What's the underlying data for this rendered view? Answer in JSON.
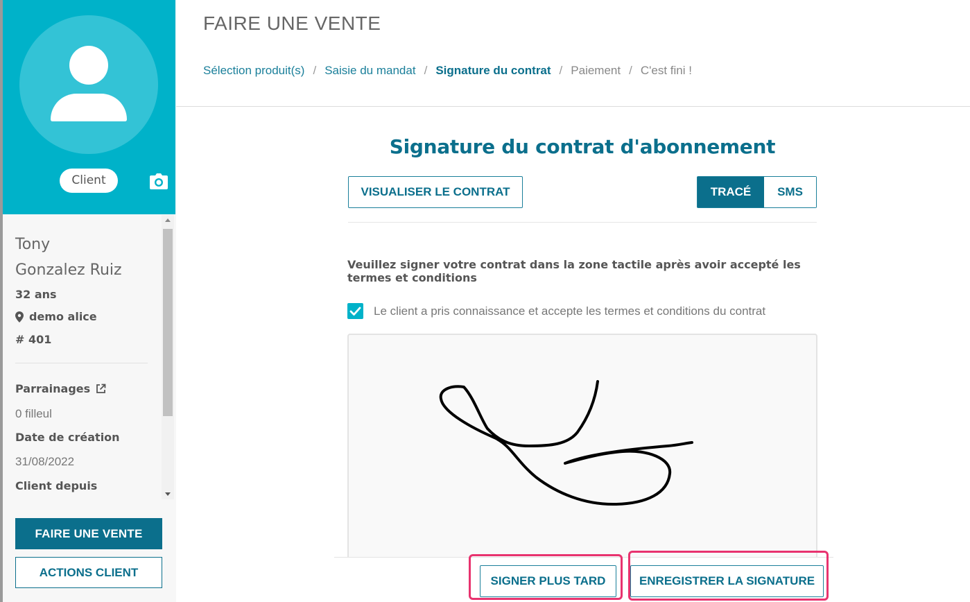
{
  "sidebar": {
    "client_badge": "Client",
    "first_name": "Tony",
    "last_name": "Gonzalez Ruiz",
    "age": "32 ans",
    "location": "demo alice",
    "client_id": "# 401",
    "referrals_label": "Parrainages",
    "referrals_value": "0 filleul",
    "creation_label": "Date de création",
    "creation_value": "31/08/2022",
    "client_since_label": "Client depuis",
    "sell_button": "FAIRE UNE VENTE",
    "actions_button": "ACTIONS CLIENT"
  },
  "header": {
    "title": "FAIRE UNE VENTE",
    "breadcrumb": [
      {
        "label": "Sélection produit(s)"
      },
      {
        "label": "Saisie du mandat"
      },
      {
        "label": "Signature du contrat"
      },
      {
        "label": "Paiement"
      },
      {
        "label": "C'est fini !"
      }
    ],
    "separator": "/"
  },
  "main": {
    "section_title": "Signature du contrat d'abonnement",
    "view_contract_button": "VISUALISER LE CONTRAT",
    "toggle": {
      "trace": "TRACÉ",
      "sms": "SMS",
      "selected": "TRACÉ"
    },
    "instructions": "Veuillez signer votre contrat dans la zone tactile après avoir accepté les termes et conditions",
    "accept_checkbox_checked": true,
    "accept_text": "Le client a pris connaissance et accepte les termes et conditions du contrat",
    "sign_later_button": "SIGNER PLUS TARD",
    "save_signature_button": "ENREGISTRER LA SIGNATURE"
  },
  "colors": {
    "brand_cyan": "#00b2c9",
    "primary_teal": "#0b6f8c",
    "highlight_pink": "#e8336f"
  },
  "icons": [
    "user-avatar-icon",
    "camera-icon",
    "location-pin-icon",
    "external-link-icon",
    "checkmark-icon",
    "scroll-up-arrow-icon",
    "scroll-down-arrow-icon"
  ]
}
